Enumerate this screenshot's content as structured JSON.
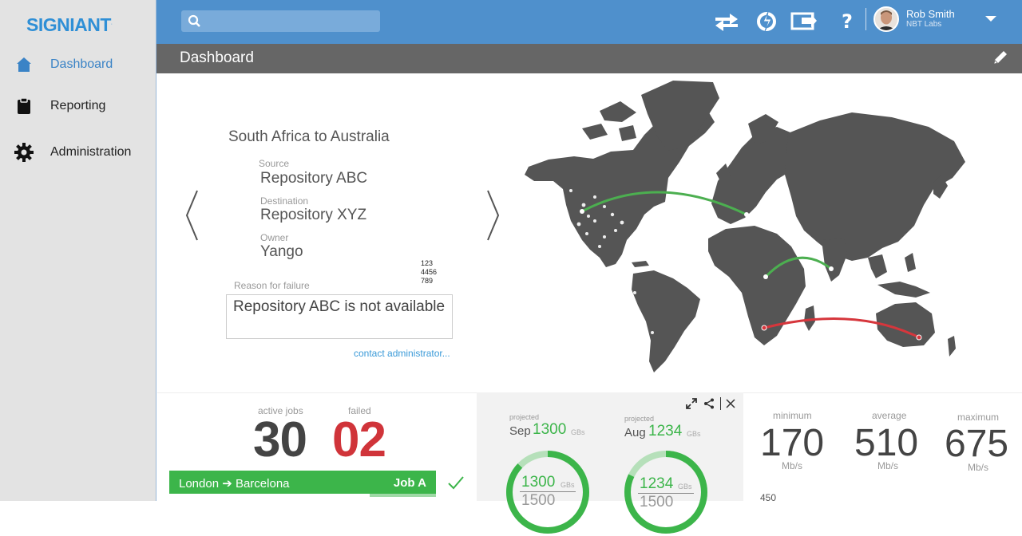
{
  "brand": {
    "name": "SIGNIANT",
    "mark": "."
  },
  "sidebar": {
    "items": [
      {
        "label": "Dashboard",
        "icon": "home-icon",
        "active": true
      },
      {
        "label": "Reporting",
        "icon": "clipboard-icon",
        "active": false
      },
      {
        "label": "Administration",
        "icon": "gear-icon",
        "active": false
      }
    ]
  },
  "topbar": {
    "search": {
      "placeholder": "",
      "value": ""
    },
    "icons": [
      "transfer-icon",
      "sync-icon",
      "cast-icon",
      "help-icon"
    ],
    "help_label": "?",
    "user": {
      "name": "Rob Smith",
      "org": "NBT Labs"
    }
  },
  "title_bar": {
    "title": "Dashboard"
  },
  "transfer_detail": {
    "route": "South Africa to Australia",
    "source_label": "Source",
    "source_value": "Repository ABC",
    "destination_label": "Destination",
    "destination_value": "Repository XYZ",
    "owner_label": "Owner",
    "owner_value": "Yango",
    "numbers": [
      "123",
      "4456",
      "789"
    ],
    "reason_label": "Reason for failure",
    "reason_text": "Repository ABC is not available",
    "contact_link": "contact administrator..."
  },
  "jobs_panel": {
    "active_label": "active jobs",
    "active_value": "30",
    "failed_label": "failed",
    "failed_value": "02",
    "job": {
      "route": "London ➔ Barcelona",
      "name": "Job A",
      "progress": 0.75
    }
  },
  "projection_panel": {
    "cards": [
      {
        "projected_label": "projected",
        "month": "Sep",
        "value": "1300",
        "unit": "GBs",
        "ring_value": "1300",
        "ring_unit": "GBs",
        "ring_total": "1500",
        "fraction": 0.87
      },
      {
        "projected_label": "projected",
        "month": "Aug",
        "value": "1234",
        "unit": "GBs",
        "ring_value": "1234",
        "ring_unit": "GBs",
        "ring_total": "1500",
        "fraction": 0.82
      }
    ]
  },
  "throughput_panel": {
    "minimum": {
      "label": "minimum",
      "value": "170",
      "unit": "Mb/s"
    },
    "average": {
      "label": "average",
      "value": "510",
      "unit": "Mb/s"
    },
    "maximum": {
      "label": "maximum",
      "value": "675",
      "unit": "Mb/s"
    },
    "axis_top": "450"
  },
  "colors": {
    "brand_blue": "#2f8fd6",
    "topbar": "#4f90cc",
    "titlebar": "#666666",
    "success": "#3cb54a",
    "failed": "#d0343a",
    "route_success": "#4caf50",
    "route_failed": "#d6363c"
  }
}
